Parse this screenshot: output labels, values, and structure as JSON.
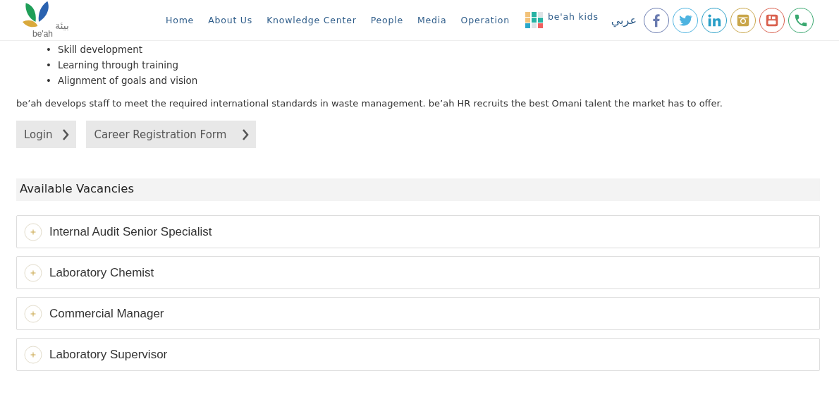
{
  "header": {
    "logo": {
      "arabic": "بيئة",
      "latin": "be'ah"
    },
    "nav": [
      {
        "label": "Home"
      },
      {
        "label": "About Us"
      },
      {
        "label": "Knowledge Center"
      },
      {
        "label": "People"
      },
      {
        "label": "Media"
      },
      {
        "label": "Operation"
      }
    ],
    "kids": "be'ah kids",
    "language": "عربي",
    "social": [
      {
        "kind": "facebook",
        "color": "#6a7bb0"
      },
      {
        "kind": "twitter",
        "color": "#4db3e0"
      },
      {
        "kind": "linkedin",
        "color": "#2a9fc7"
      },
      {
        "kind": "instagram",
        "color": "#c9a64a"
      },
      {
        "kind": "youtube",
        "color": "#d9604e"
      },
      {
        "kind": "phone",
        "color": "#3aa870"
      }
    ]
  },
  "bullet_marker": "•",
  "bullets": [
    "Skill development",
    "Learning through training",
    "Alignment of goals and vision"
  ],
  "statement": "be’ah develops staff to meet the required international standards in waste management. be’ah HR recruits the best Omani talent the market has to offer.",
  "buttons": [
    {
      "label": "Login"
    },
    {
      "label": "Career Registration Form"
    }
  ],
  "vacancies": {
    "title": "Available Vacancies",
    "items": [
      {
        "title": "Internal Audit Senior Specialist",
        "expanded": false
      },
      {
        "title": "Laboratory Chemist",
        "expanded": false
      },
      {
        "title": "Commercial Manager",
        "expanded": false
      },
      {
        "title": "Laboratory Supervisor",
        "expanded": false
      }
    ]
  }
}
